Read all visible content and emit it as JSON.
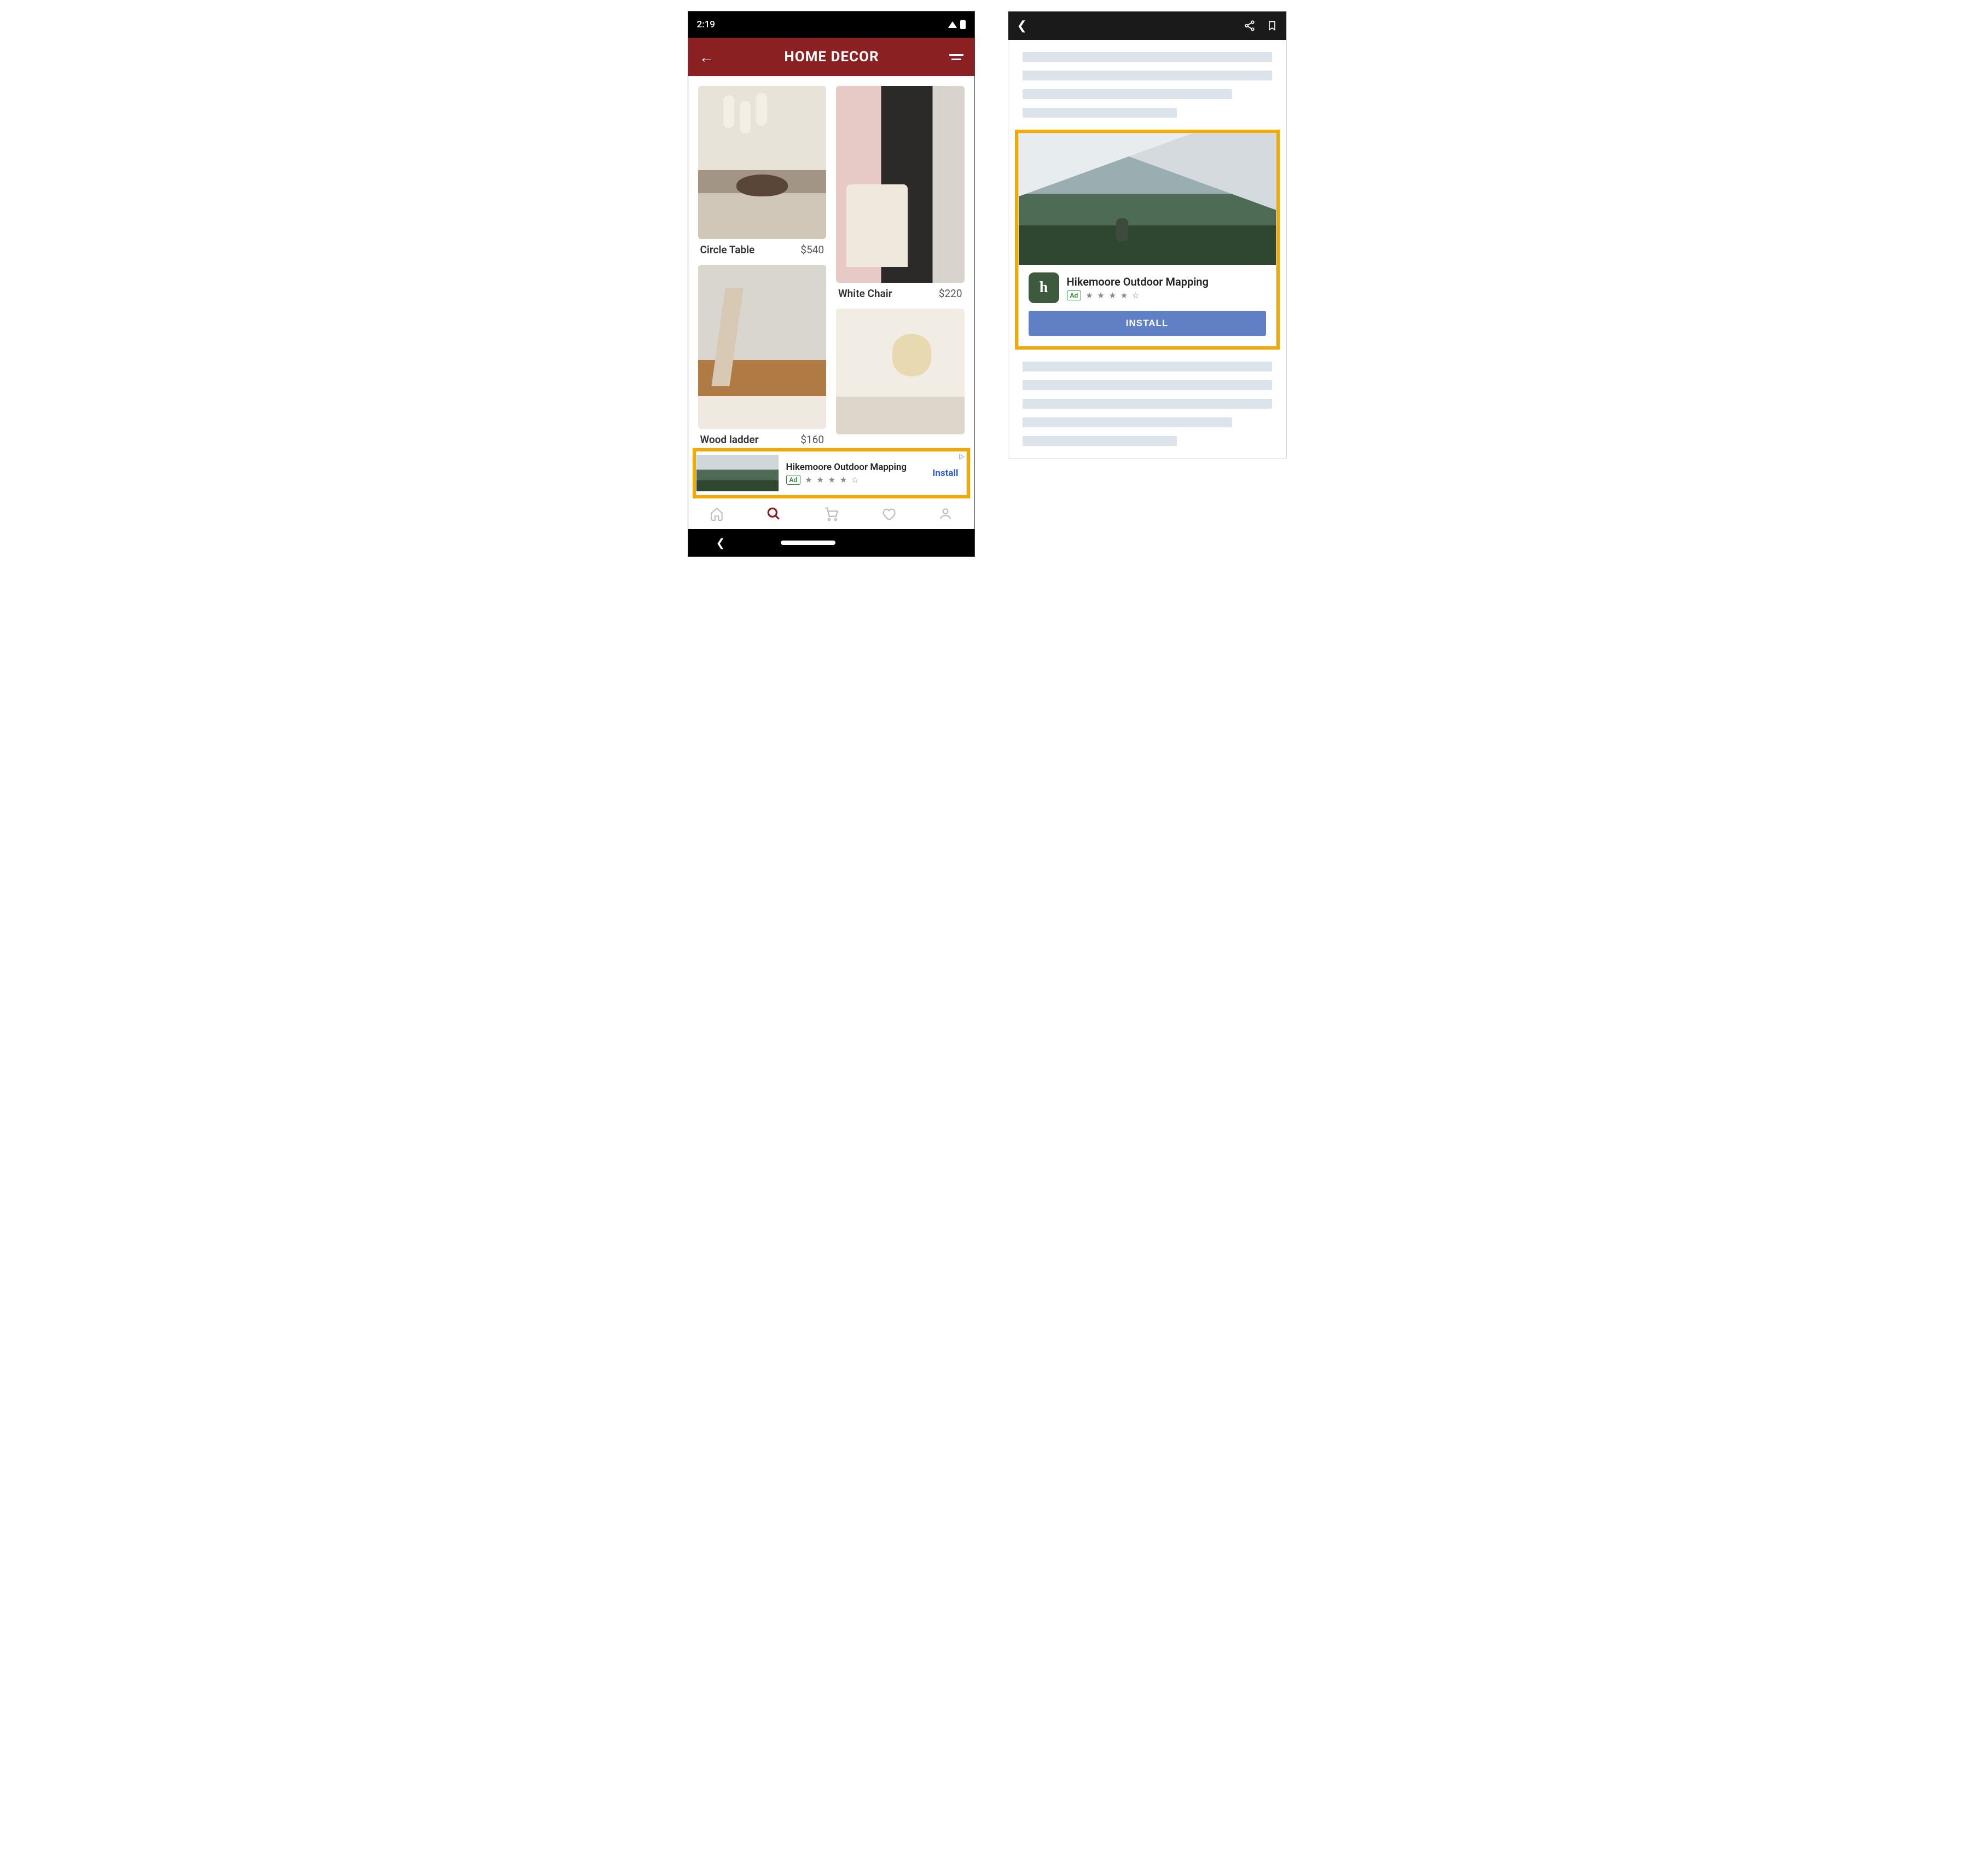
{
  "phone": {
    "status_time": "2:19",
    "appbar_title": "HOME DECOR",
    "products": [
      {
        "name": "Circle Table",
        "price": "$540"
      },
      {
        "name": "White Chair",
        "price": "$220"
      },
      {
        "name": "Wood ladder",
        "price": "$160"
      }
    ],
    "banner": {
      "title": "Hikemoore Outdoor Mapping",
      "ad_label": "Ad",
      "stars_display": "★ ★ ★ ★ ☆",
      "install": "Install"
    },
    "nav_items": [
      "home",
      "search",
      "cart",
      "favorites",
      "profile"
    ]
  },
  "article": {
    "big_ad": {
      "title": "Hikemoore Outdoor Mapping",
      "ad_label": "Ad",
      "app_icon_letter": "h",
      "stars_display": "★ ★ ★ ★ ☆",
      "install": "INSTALL"
    }
  }
}
